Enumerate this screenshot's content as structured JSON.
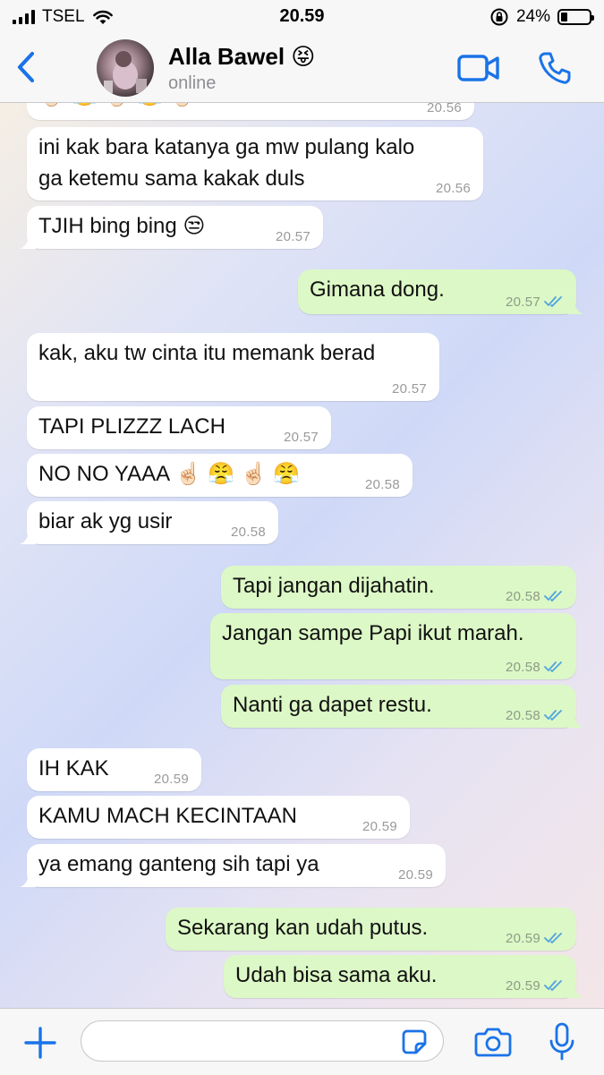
{
  "status_bar": {
    "carrier": "TSEL",
    "time": "20.59",
    "battery": "24%",
    "battery_level": 0.24
  },
  "header": {
    "contact_name": "Alla Bawel 😝",
    "contact_status": "online",
    "icons": {
      "back": "chevron-left-icon",
      "video": "video-camera-icon",
      "call": "phone-icon"
    }
  },
  "colors": {
    "accent": "#1a73e8",
    "incoming_bubble": "#ffffff",
    "outgoing_bubble": "#dcf8c6",
    "read_ticks": "#4fa3e0"
  },
  "messages": [
    {
      "id": "m0",
      "dir": "in",
      "text": "☝🏻 😤 ☝🏻 😤 ☝🏻",
      "time": "20.56"
    },
    {
      "id": "m1",
      "dir": "in",
      "text": "ini kak bara katanya ga mw pulang kalo",
      "text2": "ga ketemu sama kakak duls",
      "time": "20.56"
    },
    {
      "id": "m2",
      "dir": "in",
      "text": "TJIH bing bing 😒",
      "time": "20.57"
    },
    {
      "id": "m3",
      "dir": "out",
      "text": "Gimana dong.",
      "time": "20.57"
    },
    {
      "id": "m4",
      "dir": "in",
      "text": "kak, aku tw cinta itu memank berad",
      "time": "20.57"
    },
    {
      "id": "m5",
      "dir": "in",
      "text": "TAPI PLIZZZ LACH",
      "time": "20.57"
    },
    {
      "id": "m6",
      "dir": "in",
      "text": "NO NO YAAA ☝🏻 😤 ☝🏻 😤",
      "time": "20.58"
    },
    {
      "id": "m7",
      "dir": "in",
      "text": "biar ak yg usir",
      "time": "20.58"
    },
    {
      "id": "m8",
      "dir": "out",
      "text": "Tapi jangan dijahatin.",
      "time": "20.58"
    },
    {
      "id": "m9",
      "dir": "out",
      "text": "Jangan sampe Papi ikut marah.",
      "time": "20.58"
    },
    {
      "id": "m10",
      "dir": "out",
      "text": "Nanti ga dapet restu.",
      "time": "20.58"
    },
    {
      "id": "m11",
      "dir": "in",
      "text": "IH KAK",
      "time": "20.59"
    },
    {
      "id": "m12",
      "dir": "in",
      "text": "KAMU MACH KECINTAAN",
      "time": "20.59"
    },
    {
      "id": "m13",
      "dir": "in",
      "text": "ya emang ganteng sih tapi ya",
      "time": "20.59"
    },
    {
      "id": "m14",
      "dir": "out",
      "text": "Sekarang kan udah putus.",
      "time": "20.59"
    },
    {
      "id": "m15",
      "dir": "out",
      "text": "Udah bisa sama aku.",
      "time": "20.59"
    }
  ],
  "input_bar": {
    "placeholder": "",
    "value": "",
    "icons": {
      "plus": "plus-icon",
      "sticker": "sticker-icon",
      "camera": "camera-icon",
      "mic": "microphone-icon"
    }
  }
}
